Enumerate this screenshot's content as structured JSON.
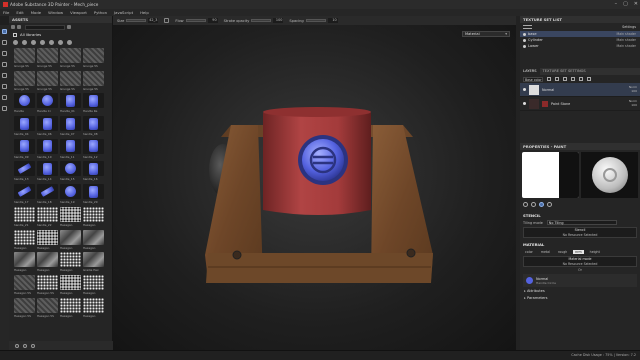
{
  "window": {
    "title": "Adobe Substance 3D Painter - Mech_piece",
    "controls": [
      "–",
      "▢",
      "✕"
    ]
  },
  "menu": [
    "File",
    "Edit",
    "Mode",
    "Window",
    "Viewport",
    "Python",
    "JavaScript",
    "Help"
  ],
  "toolbar": {
    "size_label": "Size",
    "size_value": "42_3",
    "flow_label": "Flow",
    "flow_value": "90",
    "stroke_label": "Stroke opacity",
    "stroke_value": "100",
    "spacing_label": "Spacing",
    "spacing_value": "10"
  },
  "assets": {
    "title": "ASSETS",
    "library": "All libraries",
    "items": [
      {
        "label": "Grunge 5S",
        "kind": "stone"
      },
      {
        "label": "Grunge 5S",
        "kind": "stone"
      },
      {
        "label": "Grunge 5S",
        "kind": "stone"
      },
      {
        "label": "Grunge 5S",
        "kind": "stone"
      },
      {
        "label": "Grunge 5S",
        "kind": "stone"
      },
      {
        "label": "Grunge 5S",
        "kind": "stone"
      },
      {
        "label": "Grunge 5S",
        "kind": "stone"
      },
      {
        "label": "Grunge 5S",
        "kind": "stone"
      },
      {
        "label": "Handle",
        "kind": "round"
      },
      {
        "label": "Handle Ci",
        "kind": "round"
      },
      {
        "label": "Handle_01",
        "kind": "sq"
      },
      {
        "label": "Handle Re",
        "kind": "sq"
      },
      {
        "label": "handle_04",
        "kind": "sq"
      },
      {
        "label": "handle_06",
        "kind": "sq"
      },
      {
        "label": "handle_07",
        "kind": "sq"
      },
      {
        "label": "handle_08",
        "kind": "sq"
      },
      {
        "label": "handle_09",
        "kind": "sq"
      },
      {
        "label": "handle_10",
        "kind": "sq"
      },
      {
        "label": "handle_11",
        "kind": "sq"
      },
      {
        "label": "handle_12",
        "kind": "sq"
      },
      {
        "label": "handle_13",
        "kind": "bar"
      },
      {
        "label": "handle_14",
        "kind": "sq"
      },
      {
        "label": "handle_15",
        "kind": "round"
      },
      {
        "label": "handle_16",
        "kind": "sq"
      },
      {
        "label": "handle_17",
        "kind": "bar"
      },
      {
        "label": "handle_18",
        "kind": "bar"
      },
      {
        "label": "handle_19",
        "kind": "round"
      },
      {
        "label": "handle_20",
        "kind": "sq"
      },
      {
        "label": "handle_21",
        "kind": "pattern"
      },
      {
        "label": "handle_22",
        "kind": "pattern"
      },
      {
        "label": "Hexagon",
        "kind": "patternw"
      },
      {
        "label": "Hexagon",
        "kind": "pattern"
      },
      {
        "label": "Hexagon",
        "kind": "pattern"
      },
      {
        "label": "Hexagon",
        "kind": "patternw"
      },
      {
        "label": "Hexagon",
        "kind": "grunge"
      },
      {
        "label": "Hexagon",
        "kind": "grunge"
      },
      {
        "label": "Hexagon",
        "kind": "grunge"
      },
      {
        "label": "Hexagon",
        "kind": "grunge"
      },
      {
        "label": "Hexagon",
        "kind": "pattern"
      },
      {
        "label": "Gradie Hex",
        "kind": "grunge"
      },
      {
        "label": "Hexagon 5S",
        "kind": "stone"
      },
      {
        "label": "Hexagon 5S",
        "kind": "pattern"
      },
      {
        "label": "Hexagon",
        "kind": "patternw"
      },
      {
        "label": "Hexagon",
        "kind": "pattern"
      },
      {
        "label": "Hexagon 5S",
        "kind": "stone"
      },
      {
        "label": "Hexagon 5S",
        "kind": "stone"
      },
      {
        "label": "Hexagon",
        "kind": "pattern"
      },
      {
        "label": "Hexagon",
        "kind": "pattern"
      }
    ]
  },
  "viewport": {
    "display_mode": "Material"
  },
  "texture_set_list": {
    "title": "TEXTURE SET LIST",
    "settings": "Settings",
    "rows": [
      {
        "name": "base",
        "shader": "Main shader",
        "selected": true
      },
      {
        "name": "Cylinder",
        "shader": "Main shader",
        "selected": false
      },
      {
        "name": "Lower",
        "shader": "Main shader",
        "selected": false
      }
    ]
  },
  "layers_panel": {
    "tabs": [
      "LAYERS",
      "TEXTURE SET SETTINGS"
    ],
    "channel": "Base color",
    "layers": [
      {
        "name": "Normal",
        "blend": "Norm",
        "opacity": "100",
        "selected": true,
        "thumb": "light"
      },
      {
        "name": "Paint Stone",
        "blend": "Norm",
        "opacity": "100",
        "selected": false,
        "thumb": "red"
      }
    ]
  },
  "properties": {
    "title": "PROPERTIES - PAINT",
    "stencil_title": "STENCIL",
    "tiling_label": "Tiling mode",
    "tiling_value": "No Tiling",
    "stencil_resource": "Stencil",
    "no_resource": "No Resource Selected",
    "material_title": "MATERIAL",
    "material_channels": [
      "color",
      "metal",
      "rough",
      "nrm",
      "height"
    ],
    "material_active": "nrm",
    "material_mode": "Material mode",
    "or_label": "Or",
    "normal_title": "Normal",
    "normal_sub": "Handle Circle",
    "attributes": "Attributes",
    "parameters": "Parameters"
  },
  "status": {
    "cache": "Cache Disk Usage : 75% | Version: 7.2"
  },
  "colors": {
    "accent": "#4a6ea8",
    "canister_red": "#a33b3b",
    "wood": "#7a5232",
    "emblem_blue": "#5462e0"
  }
}
